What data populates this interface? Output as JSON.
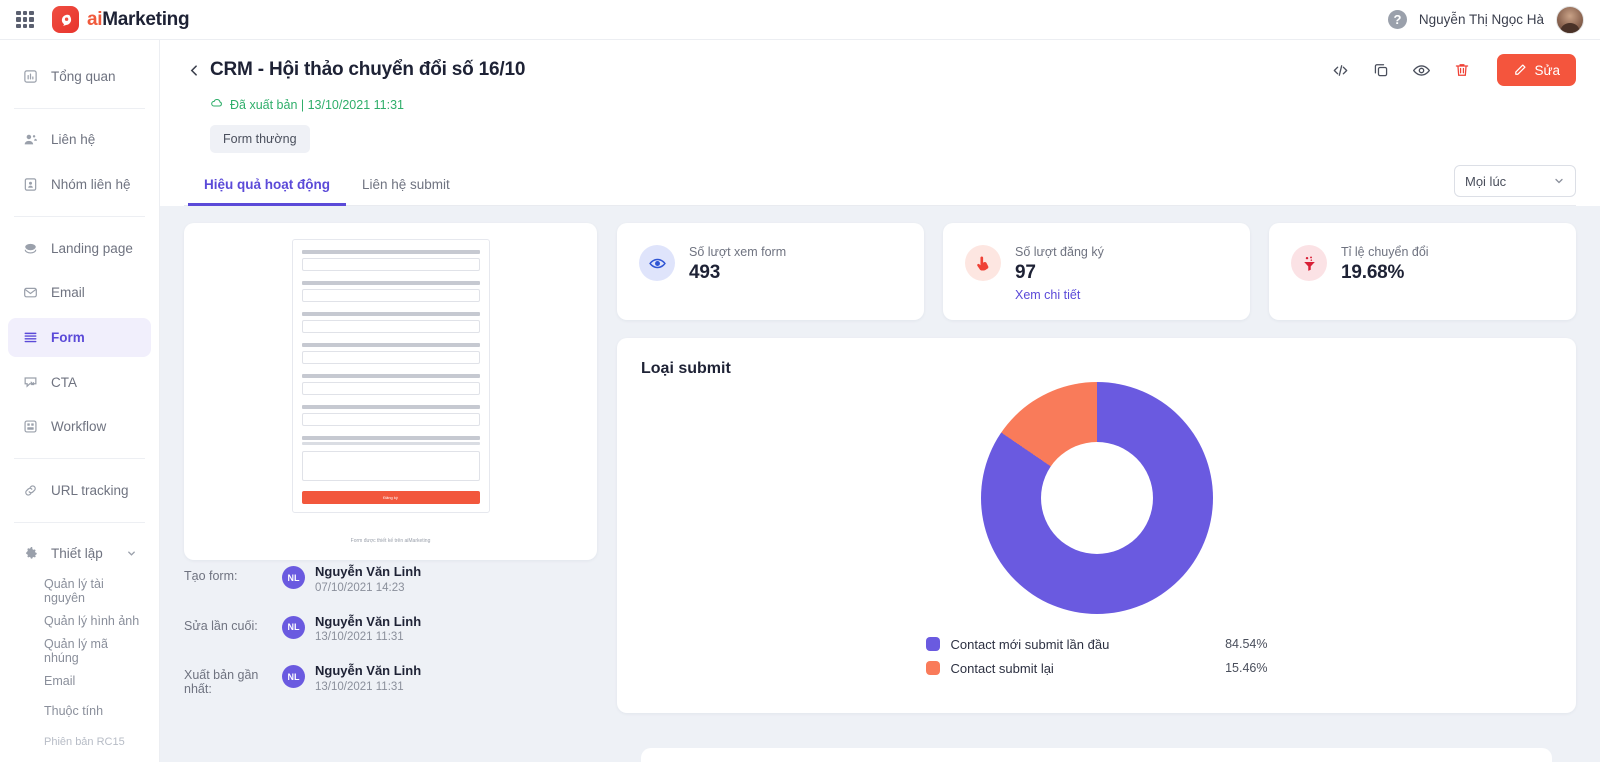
{
  "topbar": {
    "apps_icon": "grid-apps-icon",
    "brand_ai": "ai",
    "brand_marketing": "Marketing",
    "help_icon": "?",
    "user_name": "Nguyễn Thị Ngọc Hà"
  },
  "sidebar": {
    "items": [
      {
        "label": "Tổng quan",
        "icon": "dashboard-icon",
        "active": false
      },
      {
        "label": "Liên hệ",
        "icon": "contact-icon",
        "active": false
      },
      {
        "label": "Nhóm liên hệ",
        "icon": "contact-group-icon",
        "active": false
      },
      {
        "label": "Landing page",
        "icon": "landing-page-icon",
        "active": false
      },
      {
        "label": "Email",
        "icon": "email-icon",
        "active": false
      },
      {
        "label": "Form",
        "icon": "form-icon",
        "active": true
      },
      {
        "label": "CTA",
        "icon": "cta-icon",
        "active": false
      },
      {
        "label": "Workflow",
        "icon": "workflow-icon",
        "active": false
      },
      {
        "label": "URL tracking",
        "icon": "link-icon",
        "active": false
      },
      {
        "label": "Thiết lập",
        "icon": "gear-icon",
        "active": false
      }
    ],
    "sub_items": [
      "Quản lý tài nguyên",
      "Quản lý hình ảnh",
      "Quản lý mã nhúng",
      "Email",
      "Thuộc tính"
    ],
    "version": "Phiên bản RC15"
  },
  "page": {
    "title": "CRM - Hội thảo chuyển đổi số 16/10",
    "published_status": "Đã xuất bản | 13/10/2021 11:31",
    "form_type_chip": "Form thường",
    "edit_button": "Sửa",
    "actions": [
      "embed-code-icon",
      "duplicate-icon",
      "preview-eye-icon",
      "delete-trash-icon"
    ]
  },
  "tabs": [
    {
      "label": "Hiệu quả hoạt động",
      "active": true
    },
    {
      "label": "Liên hệ submit",
      "active": false
    }
  ],
  "range_filter": {
    "value": "Mọi lúc"
  },
  "preview": {
    "submit_button": "Đăng ký",
    "footer": "Form được thiết kế trên aiMarketing"
  },
  "meta": [
    {
      "key": "Tạo form:",
      "initials": "NL",
      "name": "Nguyễn Văn Linh",
      "date": "07/10/2021 14:23"
    },
    {
      "key": "Sửa lần cuối:",
      "initials": "NL",
      "name": "Nguyễn Văn Linh",
      "date": "13/10/2021 11:31"
    },
    {
      "key": "Xuất bản gần nhất:",
      "initials": "NL",
      "name": "Nguyễn Văn Linh",
      "date": "13/10/2021 11:31"
    }
  ],
  "stats": [
    {
      "label": "Số lượt xem form",
      "value": "493",
      "icon": "eye-icon",
      "icon_bg": "#dfe4fb",
      "icon_color": "#2f55d4",
      "link": null
    },
    {
      "label": "Số lượt đăng ký",
      "value": "97",
      "icon": "click-hand-icon",
      "icon_bg": "#fde6e1",
      "icon_color": "#ef4136",
      "link": "Xem chi tiết"
    },
    {
      "label": "Tỉ lệ chuyển đổi",
      "value": "19.68%",
      "icon": "funnel-icon",
      "icon_bg": "#fbe2e5",
      "icon_color": "#d81f36",
      "link": null
    }
  ],
  "chart_data": {
    "type": "pie",
    "title": "Loại submit",
    "categories": [
      "Contact mới submit lần đầu",
      "Contact submit lại"
    ],
    "values": [
      84.54,
      15.46
    ],
    "value_labels": [
      "84.54%",
      "15.46%"
    ],
    "colors": [
      "#6a5ae0",
      "#f97b5a"
    ],
    "donut": true,
    "legend_position": "bottom"
  },
  "colors": {
    "accent_purple": "#5b4ad8",
    "accent_orange": "#f4553d",
    "published_green": "#2fae6a",
    "page_bg": "#eef1f6"
  }
}
